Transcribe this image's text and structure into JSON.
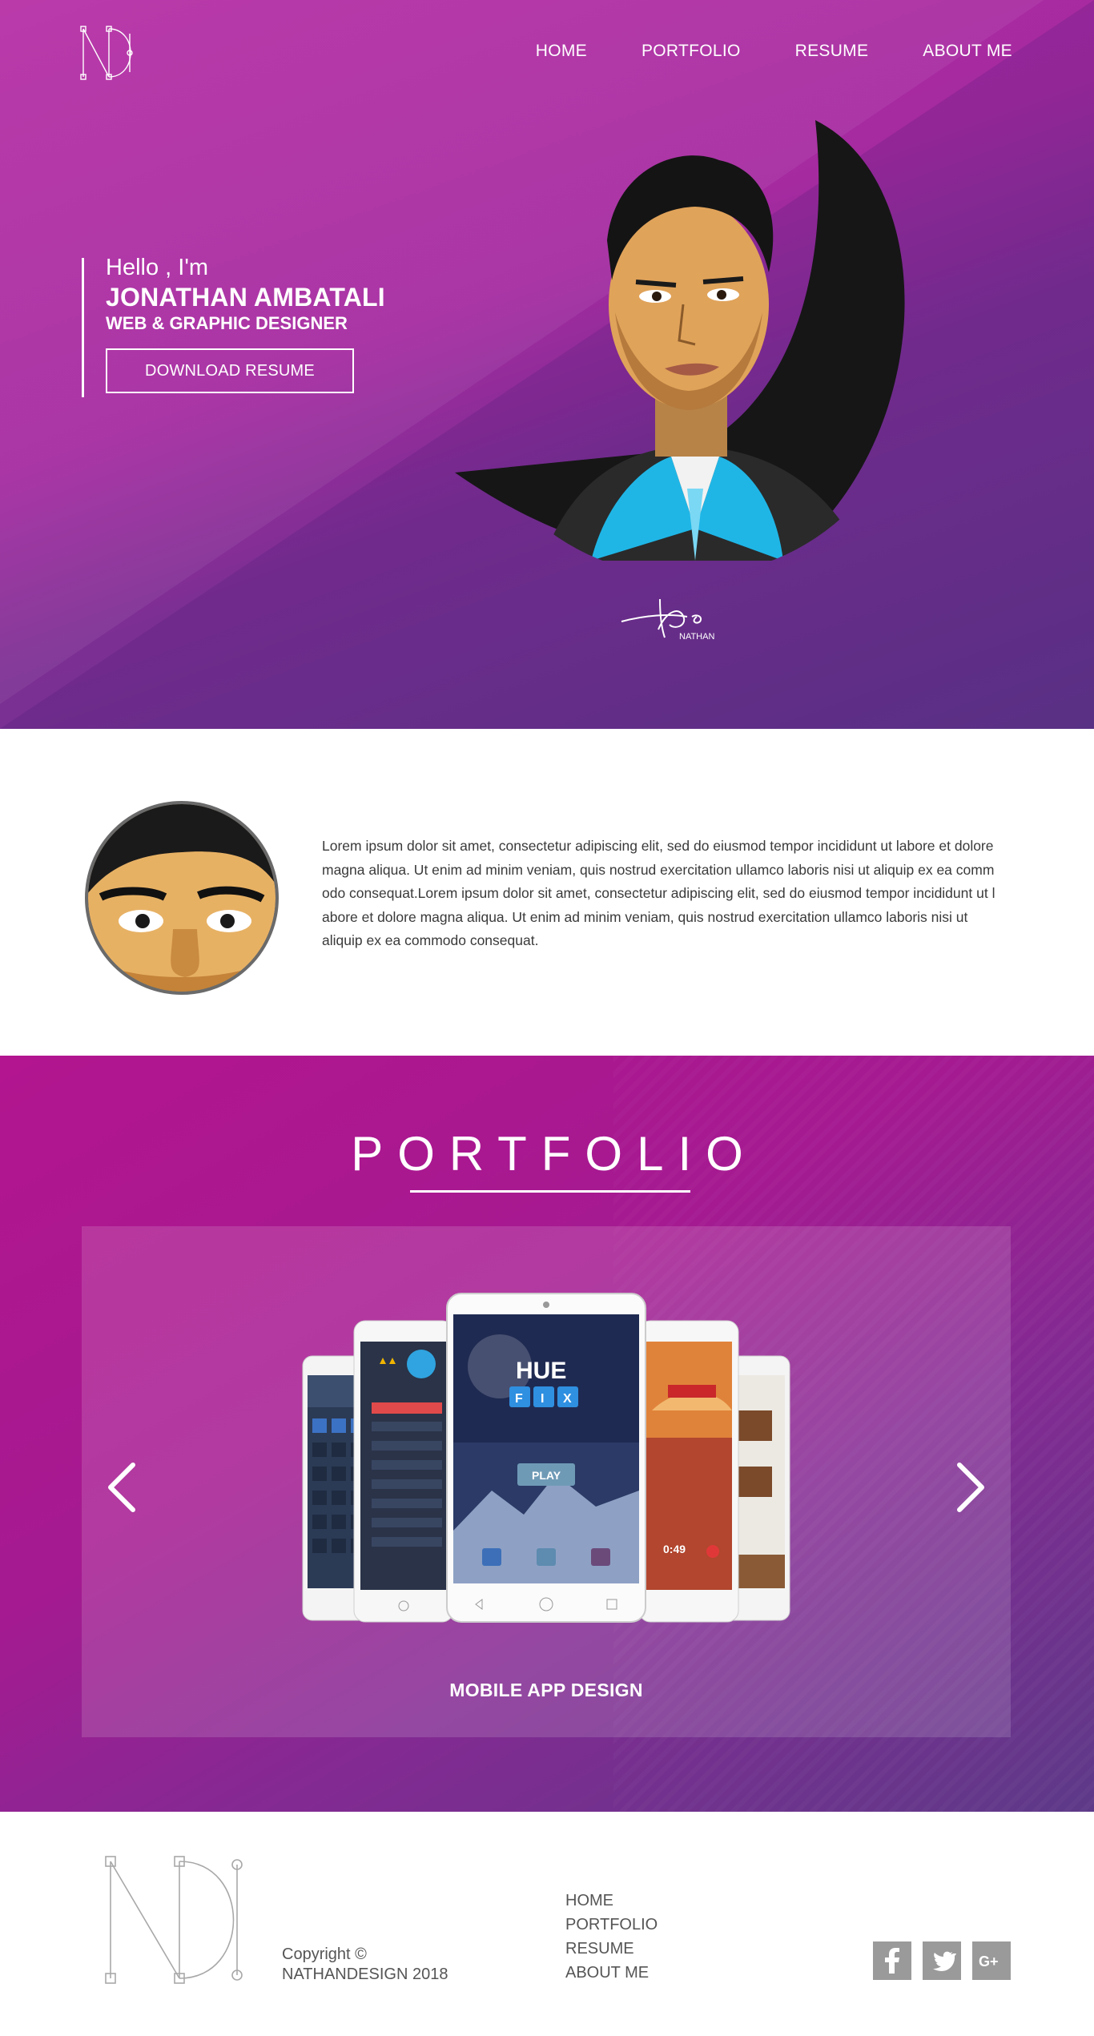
{
  "nav": {
    "items": [
      "HOME",
      "PORTFOLIO",
      "RESUME",
      "ABOUT ME"
    ]
  },
  "hero": {
    "greeting": "Hello , I'm",
    "name": "JONATHAN AMBATALI",
    "role": "WEB & GRAPHIC DESIGNER",
    "cta": "DOWNLOAD RESUME",
    "signature_text": "NATHAN"
  },
  "about": {
    "text": "Lorem ipsum dolor sit amet, consectetur adipiscing elit, sed do eiusmod tempor incididunt ut labore et dolore magna aliqua. Ut enim ad minim veniam, quis nostrud exercitation ullamco laboris nisi ut aliquip ex ea comm odo consequat.Lorem ipsum dolor sit amet, consectetur adipiscing elit, sed do eiusmod tempor incididunt ut l abore et dolore magna aliqua. Ut enim ad minim veniam, quis nostrud exercitation ullamco laboris nisi ut aliquip ex ea commodo consequat."
  },
  "portfolio": {
    "title": "PORTFOLIO",
    "caption": "MOBILE APP DESIGN",
    "app_title_top": "HUE",
    "app_title_bottom": [
      "F",
      "I",
      "X"
    ],
    "play_label": "PLAY",
    "timer": "0:49"
  },
  "footer": {
    "copyright_line1": "Copyright ©",
    "copyright_line2": "NATHANDESIGN 2018",
    "nav": [
      "HOME",
      "PORTFOLIO",
      "RESUME",
      "ABOUT ME"
    ],
    "social_icons": [
      "facebook-icon",
      "twitter-icon",
      "google-plus-icon"
    ]
  },
  "colors": {
    "hero_start": "#b62ea5",
    "hero_end": "#5f3689",
    "portfolio_start": "#b2158f",
    "portfolio_end": "#5c3a88",
    "social_gray": "#9a9a9a"
  }
}
